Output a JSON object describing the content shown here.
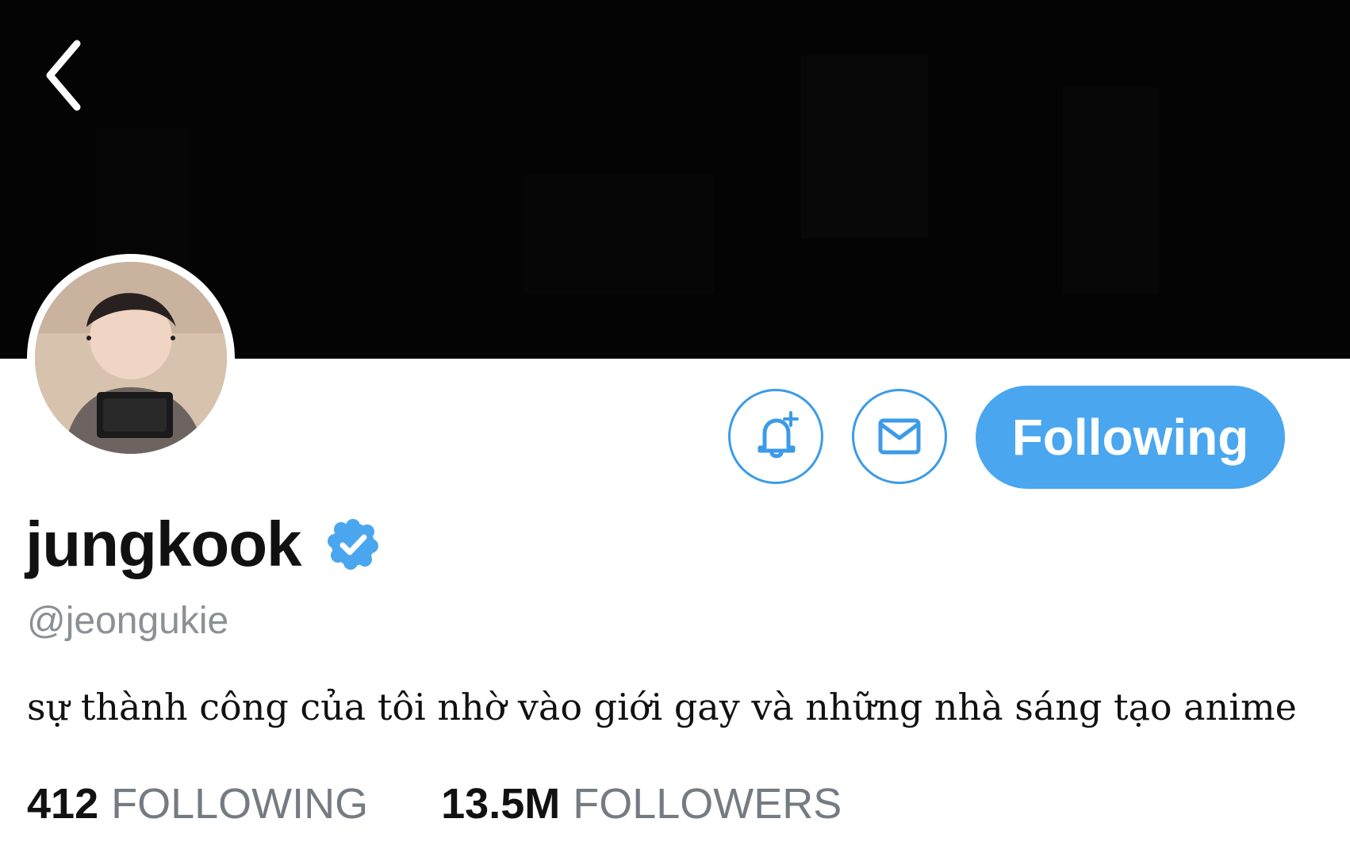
{
  "profile": {
    "display_name": "jungkook",
    "handle": "@jeongukie",
    "bio": "sự thành công của tôi nhờ vào giới gay và những nhà sáng tạo anime",
    "verified": true
  },
  "actions": {
    "follow_label": "Following",
    "notification_icon": "bell-plus-icon",
    "message_icon": "mail-icon"
  },
  "stats": {
    "following_count": "412",
    "following_label": "FOLLOWING",
    "followers_count": "13.5M",
    "followers_label": "FOLLOWERS"
  },
  "theme": {
    "accent": "#4aa6ee",
    "outline": "#3c9be8",
    "banner": "#040404",
    "muted_text": "#8a9096"
  }
}
